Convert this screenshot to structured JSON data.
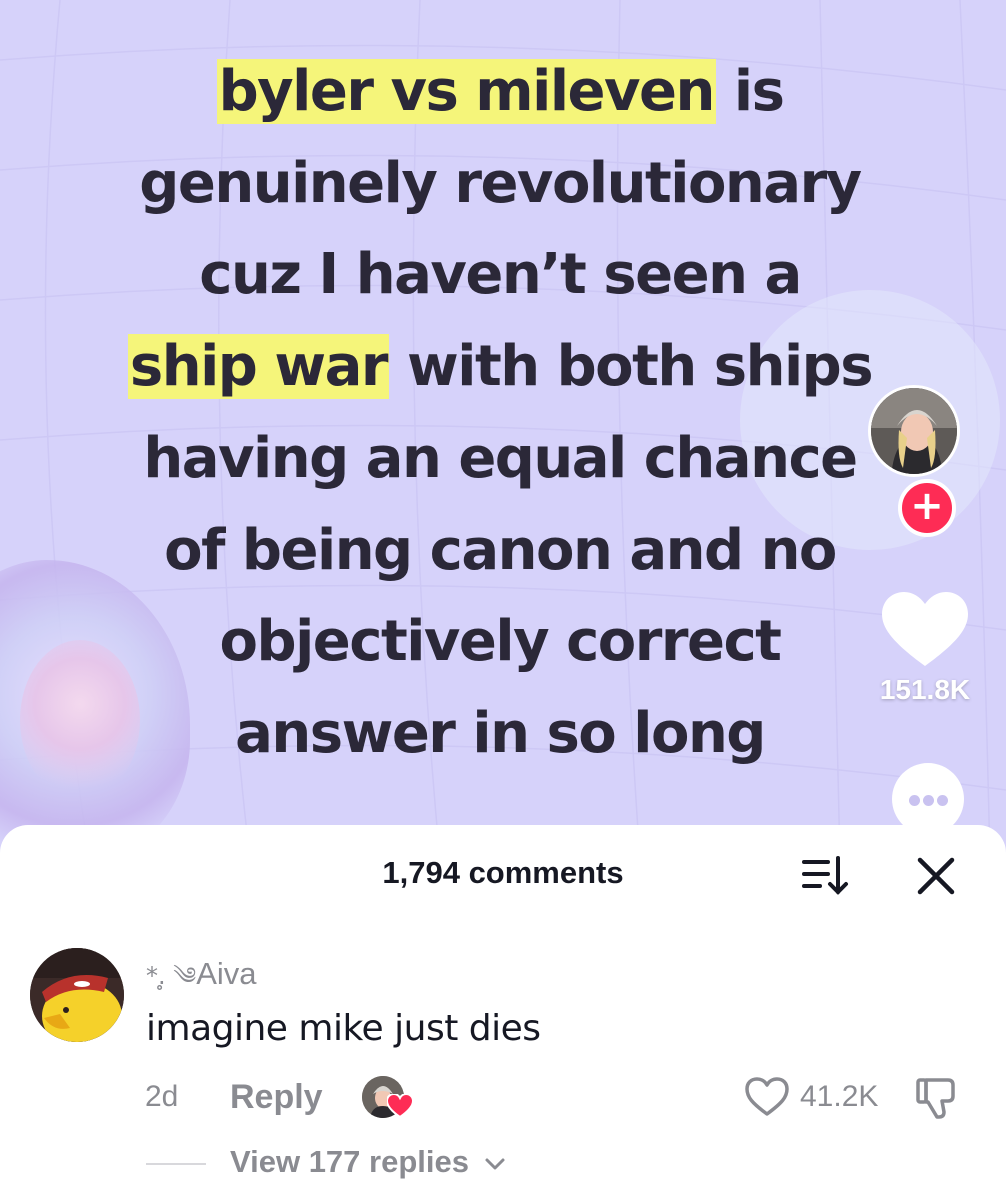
{
  "video": {
    "caption_lines": [
      {
        "parts": [
          {
            "text": "byler vs mileven",
            "highlight": true
          },
          {
            "text": " is",
            "highlight": false
          }
        ]
      },
      {
        "parts": [
          {
            "text": "genuinely revolutionary",
            "highlight": false
          }
        ]
      },
      {
        "parts": [
          {
            "text": "cuz I haven’t seen a",
            "highlight": false
          }
        ]
      },
      {
        "parts": [
          {
            "text": "ship war",
            "highlight": true
          },
          {
            "text": " with both ships",
            "highlight": false
          }
        ]
      },
      {
        "parts": [
          {
            "text": "having an equal chance",
            "highlight": false
          }
        ]
      },
      {
        "parts": [
          {
            "text": "of being canon and no",
            "highlight": false
          }
        ]
      },
      {
        "parts": [
          {
            "text": "objectively correct",
            "highlight": false
          }
        ]
      },
      {
        "parts": [
          {
            "text": "answer in so long",
            "highlight": false
          }
        ]
      }
    ],
    "highlight_color": "#f5f57a",
    "background_color": "#d6d2fa"
  },
  "rail": {
    "follow_label": "+",
    "like_count": "151.8K",
    "more_icon": "more-horizontal-icon"
  },
  "comments_panel": {
    "title": "1,794 comments",
    "sort_icon": "sort-icon",
    "close_icon": "close-icon"
  },
  "comment": {
    "username_decoration": "*.̥ ༄",
    "username": "Aiva",
    "text": "imagine mike just dies",
    "age": "2d",
    "reply_label": "Reply",
    "like_count": "41.2K",
    "view_replies_label": "View 177 replies"
  },
  "colors": {
    "accent_red": "#fe2c55",
    "text_primary": "#161823",
    "text_secondary": "#8a8b91"
  }
}
